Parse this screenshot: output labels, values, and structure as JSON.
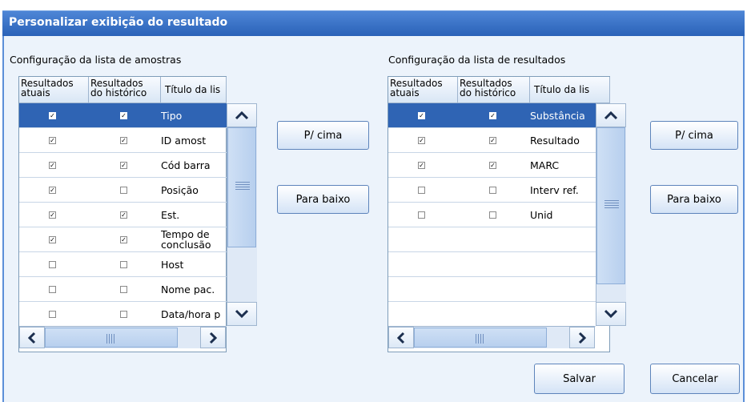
{
  "window": {
    "title": "Personalizar exibição do resultado"
  },
  "samples": {
    "section_title": "Configuração da lista de amostras",
    "columns": [
      "Resultados atuais",
      "Resultados do histórico",
      "Título da lis"
    ],
    "col_current_l1": "Resultados",
    "col_current_l2": "atuais",
    "col_hist_l1": "Resultados",
    "col_hist_l2": "do histórico",
    "col_title": "Título da lis",
    "rows": [
      {
        "title": "Tipo",
        "current": true,
        "history": true,
        "selected": true
      },
      {
        "title": "ID amost",
        "current": true,
        "history": true
      },
      {
        "title": "Cód barra",
        "current": true,
        "history": true
      },
      {
        "title": "Posição",
        "current": true,
        "history": false
      },
      {
        "title": "Est.",
        "current": true,
        "history": true
      },
      {
        "title": "Tempo de conclusão",
        "title_l1": "Tempo de",
        "title_l2": "conclusão",
        "current": true,
        "history": true
      },
      {
        "title": "Host",
        "current": false,
        "history": false
      },
      {
        "title": "Nome pac.",
        "current": false,
        "history": false
      },
      {
        "title": "Data/hora p",
        "current": false,
        "history": false
      }
    ],
    "up_label": "P/ cima",
    "down_label": "Para baixo"
  },
  "results": {
    "section_title": "Configuração da lista de resultados",
    "col_current_l1": "Resultados",
    "col_current_l2": "atuais",
    "col_hist_l1": "Resultados",
    "col_hist_l2": "do histórico",
    "col_title": "Título da lis",
    "rows": [
      {
        "title": "Substância",
        "current": true,
        "history": true,
        "selected": true
      },
      {
        "title": "Resultado",
        "current": true,
        "history": true
      },
      {
        "title": "MARC",
        "current": true,
        "history": true
      },
      {
        "title": "Interv ref.",
        "current": false,
        "history": false
      },
      {
        "title": "Unid",
        "current": false,
        "history": false
      }
    ],
    "up_label": "P/ cima",
    "down_label": "Para baixo"
  },
  "footer": {
    "save_label": "Salvar",
    "cancel_label": "Cancelar"
  },
  "icons": {
    "check": "✓"
  },
  "colors": {
    "title_bar": "#2a62b8",
    "selection": "#2f64b4",
    "dialog_bg": "#ecf3fb"
  }
}
